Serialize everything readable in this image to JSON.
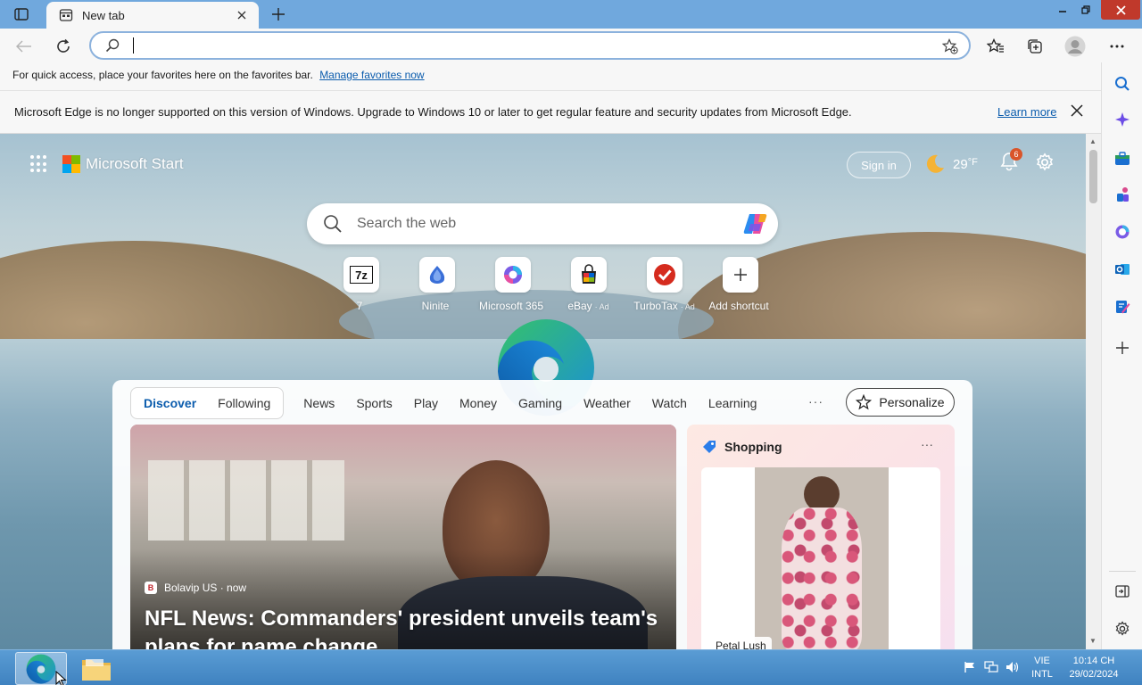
{
  "tab": {
    "title": "New tab"
  },
  "address_bar": {
    "value": "",
    "placeholder": ""
  },
  "favorites_bar": {
    "text": "For quick access, place your favorites here on the favorites bar.",
    "link": "Manage favorites now"
  },
  "notice": {
    "text": "Microsoft Edge is no longer supported on this version of Windows. Upgrade to Windows 10 or later to get regular feature and security updates from Microsoft Edge.",
    "link": "Learn more"
  },
  "start": {
    "brand": "Microsoft Start",
    "sign_in": "Sign in",
    "weather": "29",
    "weather_unit": "°F",
    "notifications": "6",
    "search_placeholder": "Search the web"
  },
  "shortcuts": [
    {
      "label": "7",
      "ad": "",
      "icon": "7zip-icon"
    },
    {
      "label": "Ninite",
      "ad": "",
      "icon": "ninite-icon"
    },
    {
      "label": "Microsoft 365",
      "ad": "",
      "icon": "m365-icon"
    },
    {
      "label": "eBay",
      "ad": "· Ad",
      "icon": "ebay-icon"
    },
    {
      "label": "TurboTax",
      "ad": "· Ad",
      "icon": "turbotax-icon"
    },
    {
      "label": "Add shortcut",
      "ad": "",
      "icon": "plus-icon"
    }
  ],
  "feed": {
    "segment_tabs": [
      "Discover",
      "Following"
    ],
    "tabs": [
      "News",
      "Sports",
      "Play",
      "Money",
      "Gaming",
      "Weather",
      "Watch",
      "Learning"
    ],
    "more": "···",
    "personalize": "Personalize"
  },
  "hero": {
    "source": "Bolavip US · now",
    "source_icon": "B",
    "headline": "NFL News: Commanders' president unveils team's plans for name change"
  },
  "shopping": {
    "title": "Shopping",
    "more": "···",
    "product_tag": "Petal Lush"
  },
  "taskbar": {
    "lang_top": "VIE",
    "lang_bottom": "INTL",
    "time": "10:14 CH",
    "date": "29/02/2024"
  },
  "colors": {
    "accent": "#0b5cad",
    "titlebar": "#70a8dd",
    "close": "#c0392b",
    "taskbar": "#4a8cc8"
  }
}
